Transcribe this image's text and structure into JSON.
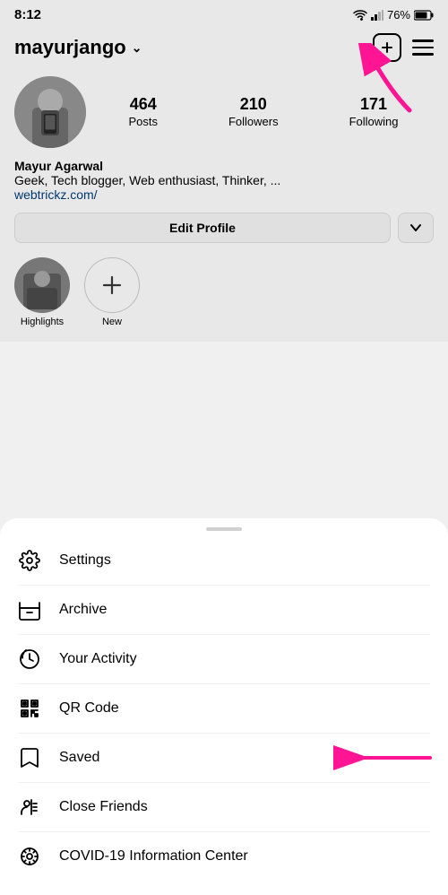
{
  "statusBar": {
    "time": "8:12",
    "battery": "76%",
    "signal": "wifi"
  },
  "profile": {
    "username": "mayurjango",
    "fullName": "Mayur Agarwal",
    "bio": "Geek, Tech blogger, Web enthusiast, Thinker, ...",
    "link": "webtrickz.com/",
    "stats": {
      "posts": {
        "count": "464",
        "label": "Posts"
      },
      "followers": {
        "count": "210",
        "label": "Followers"
      },
      "following": {
        "count": "171",
        "label": "Following"
      }
    },
    "editProfileLabel": "Edit Profile"
  },
  "highlights": [
    {
      "label": "Highlights",
      "hasImage": true
    },
    {
      "label": "New",
      "hasImage": false
    }
  ],
  "menu": {
    "items": [
      {
        "id": "settings",
        "label": "Settings",
        "icon": "gear"
      },
      {
        "id": "archive",
        "label": "Archive",
        "icon": "archive"
      },
      {
        "id": "your-activity",
        "label": "Your Activity",
        "icon": "activity"
      },
      {
        "id": "qr-code",
        "label": "QR Code",
        "icon": "qr"
      },
      {
        "id": "saved",
        "label": "Saved",
        "icon": "bookmark"
      },
      {
        "id": "close-friends",
        "label": "Close Friends",
        "icon": "close-friends"
      },
      {
        "id": "covid",
        "label": "COVID-19 Information Center",
        "icon": "covid"
      }
    ]
  }
}
